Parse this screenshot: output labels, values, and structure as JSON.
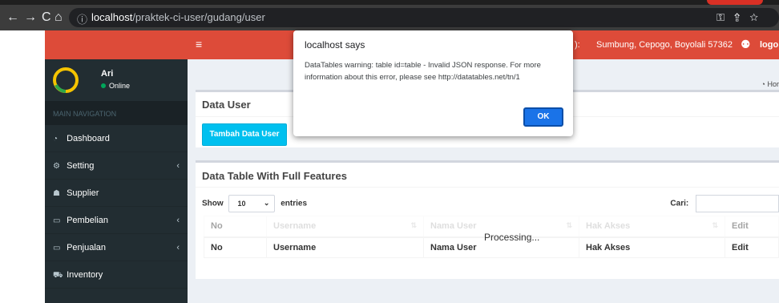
{
  "browser": {
    "url_host": "localhost",
    "url_path": "/praktek-ci-user/gudang/user"
  },
  "sidebar": {
    "user_name": "Ari",
    "user_status": "Online",
    "nav_header": "MAIN NAVIGATION",
    "items": [
      {
        "label": "Dashboard",
        "icon": "dashboard-icon",
        "chevron": ""
      },
      {
        "label": "Setting",
        "icon": "cogs-icon",
        "chevron": "‹"
      },
      {
        "label": "Supplier",
        "icon": "users-icon",
        "chevron": ""
      },
      {
        "label": "Pembelian",
        "icon": "desktop-icon",
        "chevron": "‹"
      },
      {
        "label": "Penjualan",
        "icon": "desktop-icon",
        "chevron": "‹"
      },
      {
        "label": "Inventory",
        "icon": "cart-icon",
        "chevron": ""
      }
    ]
  },
  "topbar": {
    "menu_icon": "≡",
    "colon": "):",
    "address": "Sumbung, Cepogo, Boyolali 57362",
    "logout": "logo"
  },
  "breadcrumb": "Hor",
  "box_user": {
    "title": "Data User",
    "add_button": "Tambah Data User"
  },
  "box_table": {
    "title": "Data Table With Full Features",
    "show_label": "Show",
    "entries_value": "10",
    "entries_label": "entries",
    "search_label": "Cari:",
    "columns": [
      "No",
      "Username",
      "Nama User",
      "Hak Akses",
      "Edit"
    ],
    "processing": "Processing..."
  },
  "dialog": {
    "title": "localhost says",
    "message": "DataTables warning: table id=table - Invalid JSON response. For more information about this error, please see http://datatables.net/tn/1",
    "ok": "OK"
  },
  "colors": {
    "header_red": "#dd4b39",
    "sidebar_dark": "#222d32",
    "button_cyan": "#00c0ef",
    "dialog_blue": "#1a73e8"
  }
}
